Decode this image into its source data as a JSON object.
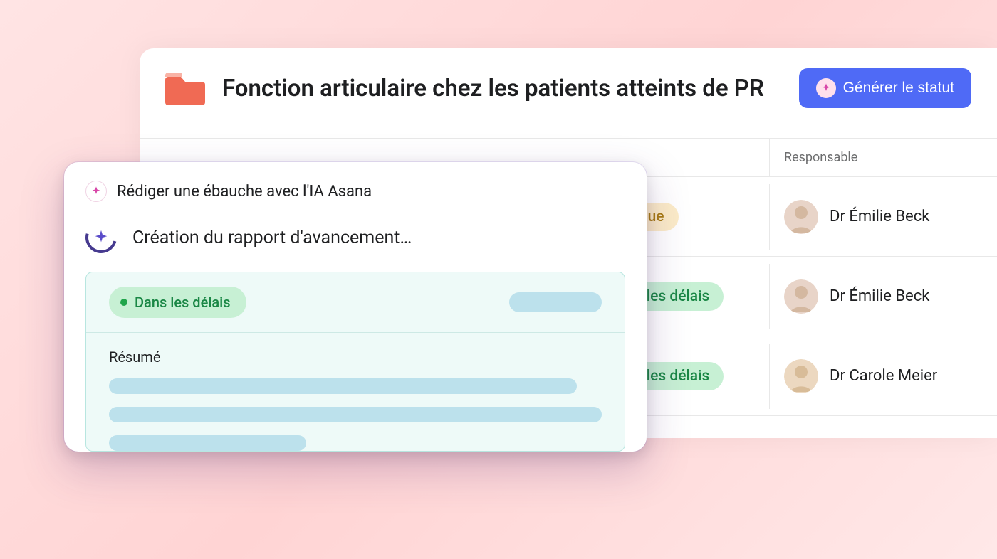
{
  "header": {
    "title": "Fonction articulaire chez les patients atteints de PR",
    "generate_button": "Générer le statut"
  },
  "table": {
    "columns": {
      "owner": "Responsable"
    },
    "rows": [
      {
        "status_text": "À risque",
        "status_kind": "risk",
        "owner": "Dr Émilie Beck"
      },
      {
        "status_text": "Dans les délais",
        "status_kind": "ontime",
        "owner": "Dr Émilie Beck"
      },
      {
        "status_text": "Dans les délais",
        "status_kind": "ontime",
        "owner": "Dr Carole Meier"
      }
    ]
  },
  "ai_modal": {
    "title": "Rédiger une ébauche avec l'IA Asana",
    "progress": "Création du rapport d'avancement…",
    "draft": {
      "status": "Dans les délais",
      "summary_label": "Résumé"
    }
  },
  "colors": {
    "accent": "#4f6af6",
    "folder": "#f06a54",
    "ontime_bg": "#c7f0d4",
    "ontime_fg": "#1a8745",
    "risk_bg": "#fcecc8",
    "risk_fg": "#a87b12"
  }
}
